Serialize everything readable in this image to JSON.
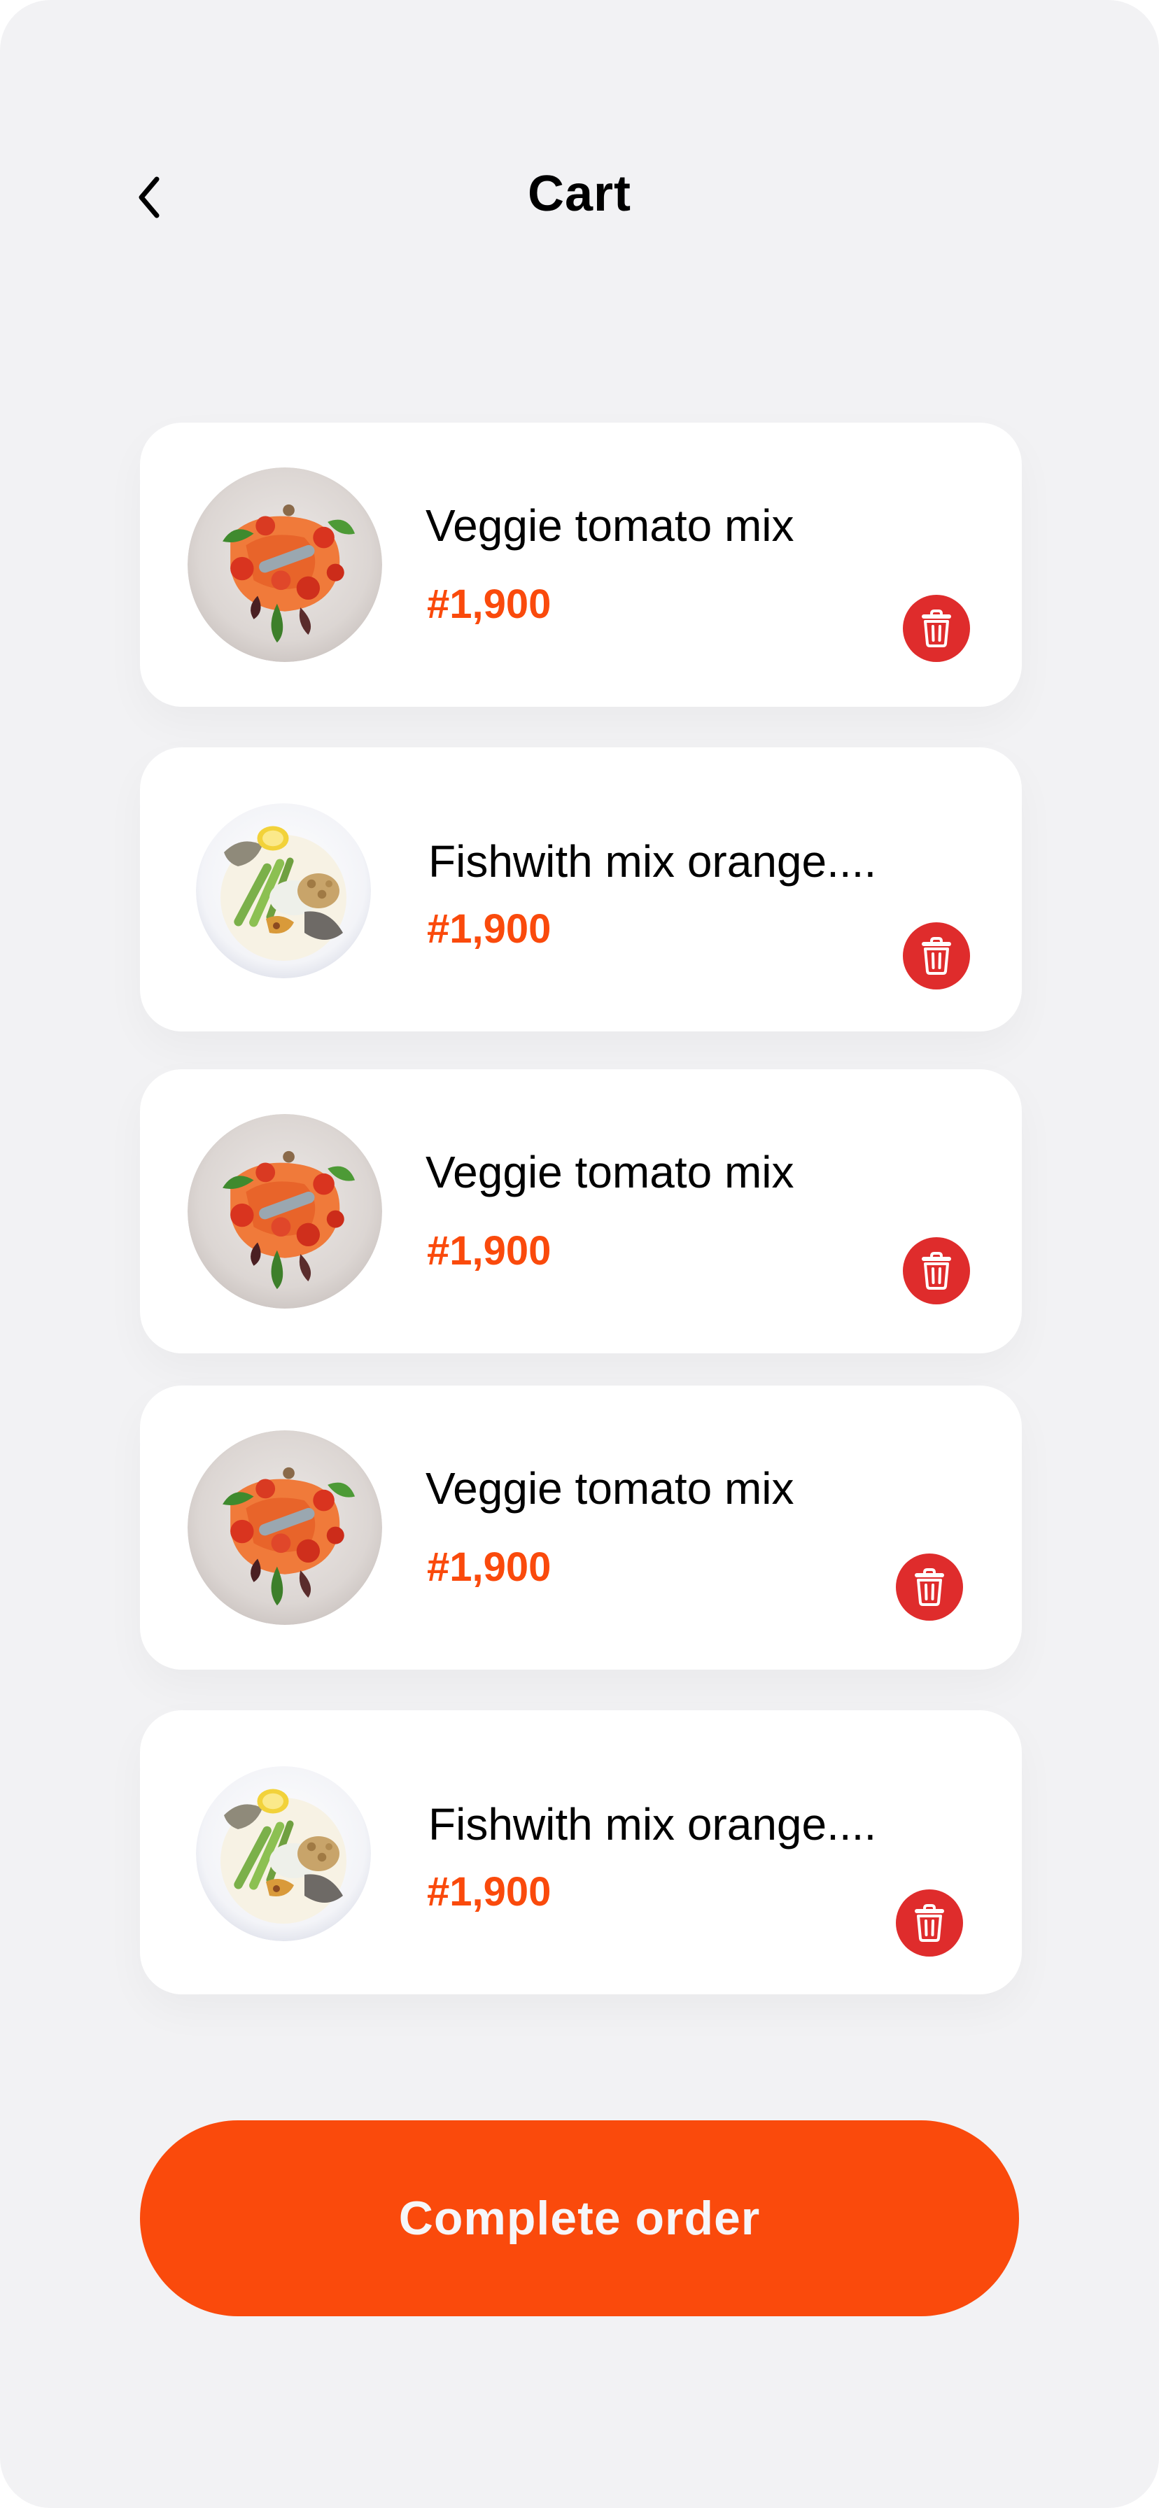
{
  "header": {
    "back_icon": "chevron-left-icon",
    "title": "Cart"
  },
  "cart": {
    "items": [
      {
        "name": "Veggie tomato mix",
        "price": "#1,900",
        "image": "veggie-tomato-plate",
        "delete_icon": "trash-icon"
      },
      {
        "name": "Fishwith mix orange....",
        "price": "#1,900",
        "image": "fish-orange-plate",
        "delete_icon": "trash-icon"
      },
      {
        "name": "Veggie tomato mix",
        "price": "#1,900",
        "image": "veggie-tomato-plate",
        "delete_icon": "trash-icon"
      },
      {
        "name": "Veggie tomato mix",
        "price": "#1,900",
        "image": "veggie-tomato-plate",
        "delete_icon": "trash-icon"
      },
      {
        "name": "Fishwith mix orange....",
        "price": "#1,900",
        "image": "fish-orange-plate",
        "delete_icon": "trash-icon"
      }
    ]
  },
  "footer": {
    "complete_label": "Complete order"
  },
  "colors": {
    "accent": "#FA4A0C",
    "delete": "#DF2C2C",
    "background": "#F2F2F4",
    "card": "#FFFFFF"
  }
}
